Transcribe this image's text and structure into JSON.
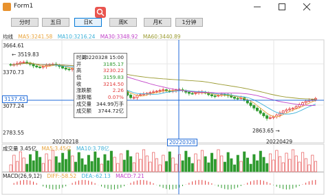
{
  "window": {
    "title": "Form1"
  },
  "toolbar": {
    "buttons": [
      {
        "label": "分时",
        "active": false
      },
      {
        "label": "五日",
        "active": false
      },
      {
        "label": "日K",
        "active": true
      },
      {
        "label": "周K",
        "active": false
      },
      {
        "label": "月K",
        "active": false
      },
      {
        "label": "1分钟",
        "active": false
      }
    ]
  },
  "kline": {
    "legend_prefix": "均线",
    "ma": [
      {
        "text": "MA5:3241.58",
        "color": "#e8a33a"
      },
      {
        "text": "MA10:3216.24",
        "color": "#3ab0d8"
      },
      {
        "text": "MA30:3348.92",
        "color": "#c040c8"
      },
      {
        "text": "MA60:3440.89",
        "color": "#9a9a30"
      }
    ],
    "y_ticks": [
      "3664.61",
      "3370.73",
      "3077.24",
      "2783.55"
    ],
    "high_label": "← 3519.83",
    "low_label": "2863.65 →",
    "crosshair_value": "3137.45",
    "crosshair_date": "20220328",
    "dates": [
      "20220218",
      "20220429"
    ]
  },
  "hover": {
    "rows": [
      {
        "k": "时间",
        "v": "20220328 15:00",
        "color": "#222222"
      },
      {
        "k": "开",
        "v": "3185.17",
        "color": "#2e9a2e"
      },
      {
        "k": "高",
        "v": "3230.22",
        "color": "#e23b3b"
      },
      {
        "k": "低",
        "v": "3159.83",
        "color": "#2e9a2e"
      },
      {
        "k": "收",
        "v": "3214.50",
        "color": "#e23b3b"
      },
      {
        "k": "涨跌额",
        "v": "2.26",
        "color": "#e23b3b"
      },
      {
        "k": "涨跌幅",
        "v": "0.07%",
        "color": "#e23b3b"
      },
      {
        "k": "成交量",
        "v": "344.99万手",
        "color": "#222222"
      },
      {
        "k": "成交额",
        "v": "3744.72亿",
        "color": "#222222"
      }
    ]
  },
  "volume": {
    "legend": [
      {
        "text": "成交量 3.45亿",
        "color": "#222222"
      },
      {
        "text": "MA5:3.45亿",
        "color": "#e8a33a"
      },
      {
        "text": "MA10:3.78亿",
        "color": "#3ab0d8"
      }
    ]
  },
  "macd": {
    "legend": [
      {
        "text": "MACD(26,9,12)",
        "color": "#222222"
      },
      {
        "text": "DIFF:-58.52",
        "color": "#e8a33a"
      },
      {
        "text": "DEA:-62.13",
        "color": "#3ab0d8"
      },
      {
        "text": "MACD:7.21",
        "color": "#c040c8"
      }
    ]
  },
  "chart_data": {
    "type": "candlestick",
    "y_axis_ticks": [
      3664.61,
      3370.73,
      3077.24,
      2783.55
    ],
    "ylim": [
      2783.55,
      3664.61
    ],
    "period_high": 3519.83,
    "period_low": 2863.65,
    "date_labels": [
      "20220218",
      "20220328",
      "20220429"
    ],
    "selected": {
      "date": "20220328",
      "open": 3185.17,
      "high": 3230.22,
      "low": 3159.83,
      "close": 3214.5
    }
  }
}
